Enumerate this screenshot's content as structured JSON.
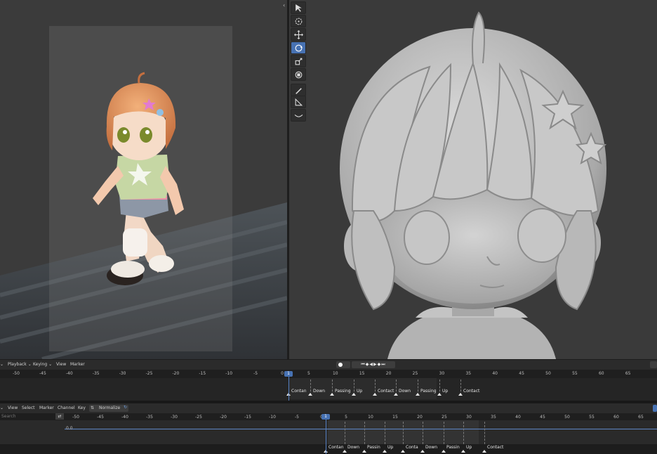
{
  "viewport_left": {
    "label": "3d-viewport-character"
  },
  "viewport_right": {
    "label": "3d-viewport-sculpt-head"
  },
  "tools": [
    "select-icon",
    "cursor-icon",
    "move-icon",
    "rotate-icon",
    "scale-icon",
    "transform-icon",
    "annotate-icon",
    "measure-icon",
    "curve-icon"
  ],
  "timeline": {
    "menus": {
      "playback": "Playback",
      "keying": "Keying",
      "view": "View",
      "marker": "Marker"
    },
    "ticks": [
      "-50",
      "-45",
      "-40",
      "-35",
      "-30",
      "-25",
      "-20",
      "-15",
      "-10",
      "-5",
      "0",
      "5",
      "10",
      "15",
      "20",
      "25",
      "30",
      "35",
      "40",
      "45",
      "50",
      "55",
      "60",
      "65"
    ],
    "current_frame": "1",
    "markers": [
      "Contan",
      "Down",
      "Passing",
      "Up",
      "Contact",
      "Down",
      "Passing",
      "Up",
      "Contact"
    ]
  },
  "graph_editor": {
    "menus": {
      "view": "View",
      "select": "Select",
      "marker": "Marker",
      "channel": "Channel",
      "key": "Key",
      "normalize": "Normalize"
    },
    "search_placeholder": "Search",
    "ticks": [
      "-50",
      "-45",
      "-40",
      "-35",
      "-30",
      "-25",
      "-20",
      "-15",
      "-10",
      "-5",
      "0",
      "5",
      "10",
      "15",
      "20",
      "25",
      "30",
      "35",
      "40",
      "45",
      "50",
      "55",
      "60",
      "65"
    ],
    "current_frame": "1",
    "value_label": "0.0",
    "markers": [
      "Contan",
      "Down",
      "Passin",
      "Up",
      "Conta",
      "Down",
      "Passin",
      "Up",
      "Contact"
    ]
  },
  "colors": {
    "accent": "#4772b3",
    "viewport_bg": "#3b3b3b"
  }
}
